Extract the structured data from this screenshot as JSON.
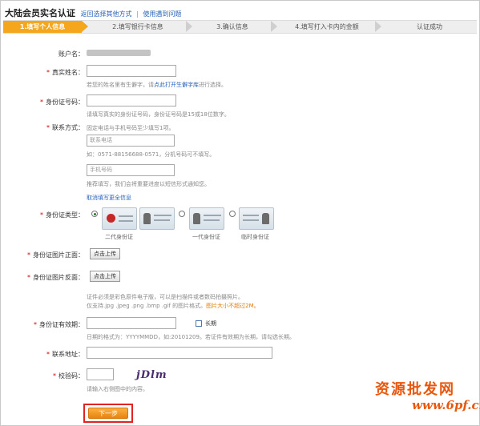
{
  "header": {
    "title": "大陆会员实名认证",
    "link_back": "返回选择其他方式",
    "separator": "|",
    "link_help": "使用遇到问题"
  },
  "steps": [
    {
      "label": "1.填写个人信息",
      "active": true
    },
    {
      "label": "2.填写银行卡信息",
      "active": false
    },
    {
      "label": "3.确认信息",
      "active": false
    },
    {
      "label": "4.填写打入卡内的金额",
      "active": false
    },
    {
      "label": "认证成功",
      "active": false
    }
  ],
  "form": {
    "account": {
      "label": "账户名："
    },
    "real_name": {
      "label": "真实姓名：",
      "hint_prefix": "若您的姓名里有生僻字，请",
      "hint_link": "点此打开生僻字库",
      "hint_suffix": "进行选择。"
    },
    "id_number": {
      "label": "身份证号码：",
      "hint": "请填写真实的身份证号码，身份证号码是15或18位数字。"
    },
    "contact": {
      "label": "联系方式：",
      "hint": "固定电话与手机号码至少填写1项。",
      "phone_placeholder": "联系电话",
      "phone_hint": "如：0571-88156688-0571，分机号码可不填写。",
      "mobile_placeholder": "手机号码",
      "mobile_hint": "推荐填写，我们会将重要进度以短信形式通知您。",
      "cancel_link": "取消填写更全信息"
    },
    "id_type": {
      "label": "身份证类型：",
      "options": [
        {
          "caption": "二代身份证",
          "selected": true
        },
        {
          "caption": "一代身份证",
          "selected": false
        },
        {
          "caption": "临时身份证",
          "selected": false
        }
      ]
    },
    "id_front": {
      "label": "身份证图片正面：",
      "button": "点击上传"
    },
    "id_back": {
      "label": "身份证图片反面：",
      "button": "点击上传"
    },
    "upload_hint": {
      "line1": "证件必须是彩色原件电子版，可以是扫描件或者数码拍摄照片。",
      "line2": "仅支持.jpg .jpeg .png .bmp .gif 的图片格式。",
      "line2_warn": "图片大小不超过2M。"
    },
    "validity": {
      "label": "身份证有效期：",
      "checkbox_label": "长期",
      "hint": "日期的格式为：YYYYMMDD，如:20101209。若证件有效期为长期，请勾选长期。"
    },
    "address": {
      "label": "联系地址："
    },
    "captcha": {
      "label": "校验码：",
      "image_text": "jDlm",
      "hint": "请输入右侧图中的内容。"
    }
  },
  "next_button": "下一步",
  "watermark": {
    "text": "资源批发网",
    "url": "www.6pf.cn"
  },
  "colors": {
    "accent": "#f4a61d",
    "required": "#d40000",
    "link": "#2a62b8",
    "highlight_box": "#e32222"
  }
}
